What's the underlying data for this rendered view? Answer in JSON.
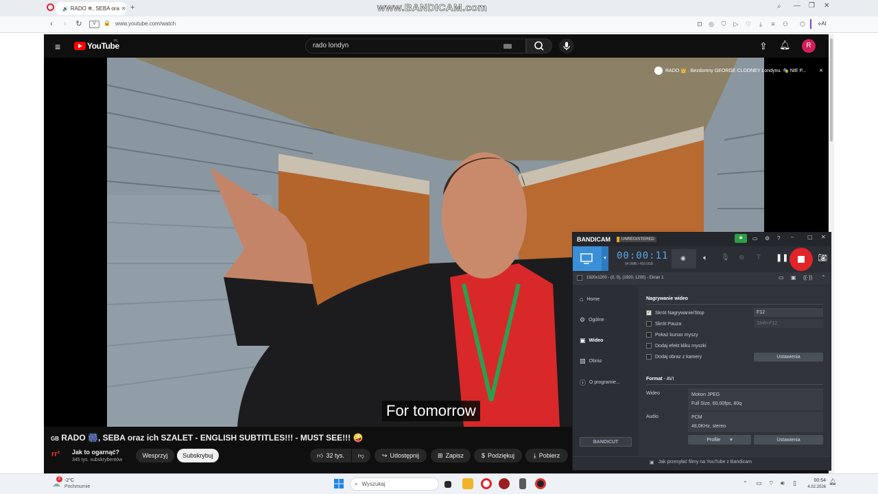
{
  "watermark": "www.BANDICAM.com",
  "browser": {
    "tab_label": "RADO ❄, SEBA ora",
    "url": "www.youtube.com/watch",
    "ai_label": "AI"
  },
  "youtube": {
    "logo": "YouTube",
    "region": "PL",
    "search_value": "rado londyn",
    "avatar_letter": "R",
    "miniplayer_title": "RADO 👑 . Bezdomny GEORGE CLOONEY Londynu. 🎭 NIE P...",
    "subtitle": "For tomorrow",
    "video_title": "RADO 🎆, SEBA oraz ich SZALET - ENGLISH SUBTITLES!!! - MUST SEE!!! 🤪",
    "title_prefix": "GB",
    "channel_name": "Jak to ogarnąć?",
    "channel_logo": "rr²",
    "subscribers": "345 tys. subskrybentów",
    "support_label": "Wesprzyj",
    "subscribe_label": "Subskrybuj",
    "likes": "32 tys.",
    "share_label": "Udostępnij",
    "save_label": "Zapisz",
    "thanks_label": "Podziękuj",
    "download_label": "Pobierz"
  },
  "bandicam": {
    "brand": "BANDICAM",
    "badge": "UNREGISTERED",
    "timer": "00:00:11",
    "size_info": "94.0MB / 459.0GB",
    "resolution": "1920x1200 - (0, 0), (1920, 1200) - Ekran 1",
    "nav": [
      "Home",
      "Ogólne",
      "Wideo",
      "Obraz",
      "O programie..."
    ],
    "section_title": "Nagrywanie wideo",
    "options": [
      {
        "label": "Skrót Nagrywanie/Stop",
        "checked": true
      },
      {
        "label": "Skrót Pauza",
        "checked": false
      },
      {
        "label": "Pokaż kursor myszy",
        "checked": false
      },
      {
        "label": "Dodaj efekt kliku myszki",
        "checked": false
      },
      {
        "label": "Dodaj obraz z kamery",
        "checked": false
      }
    ],
    "hotkey_record": "F12",
    "hotkey_pause": "Shift+F12",
    "settings_label": "Ustawienia",
    "format_label": "Format",
    "format_value": "AVI",
    "video_label": "Wideo",
    "video_codec": "Motion JPEG",
    "video_detail": "Full Size, 60,00fps, 80q",
    "audio_label": "Audio",
    "audio_codec": "PCM",
    "audio_detail": "48,0KHz, stereo",
    "profile_label": "Profile",
    "settings2_label": "Ustawienia",
    "bandicut": "BANDICUT",
    "footer": "Jak przesyłać filmy na YouTube z Bandicam"
  },
  "taskbar": {
    "weather_temp": "-2°C",
    "weather_desc": "Pochmurnie",
    "weather_badge": "2",
    "search_label": "Wyszukaj",
    "time": "00:54",
    "date": "4.02.2026"
  }
}
